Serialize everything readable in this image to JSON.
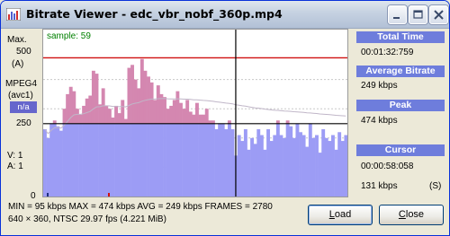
{
  "window": {
    "title": "Bitrate Viewer - edc_vbr_nobf_360p.mp4"
  },
  "axis": {
    "max_label": "Max.",
    "y_500": "500",
    "unit": "(A)",
    "codec": "MPEG4",
    "codec_sub": "(avc1)",
    "na": "n/a",
    "y_250": "250",
    "y_0": "0",
    "v_label": "V:  1",
    "a_label": "A:  1"
  },
  "graph": {
    "sample_label": "sample: 59"
  },
  "chart_data": {
    "type": "bar",
    "ylim": [
      0,
      500
    ],
    "max_line": 474,
    "avg_line": 249,
    "cursor_index": 59,
    "bitrate_kbps": [
      230,
      200,
      250,
      260,
      240,
      225,
      300,
      350,
      375,
      360,
      300,
      280,
      310,
      335,
      345,
      430,
      420,
      315,
      370,
      310,
      300,
      270,
      310,
      285,
      330,
      265,
      440,
      450,
      400,
      370,
      470,
      430,
      410,
      390,
      330,
      380,
      350,
      340,
      300,
      310,
      330,
      360,
      320,
      300,
      330,
      290,
      280,
      320,
      280,
      280,
      300,
      260,
      260,
      230,
      250,
      250,
      230,
      260,
      230,
      140,
      210,
      190,
      230,
      160,
      200,
      180,
      230,
      210,
      160,
      230,
      190,
      210,
      260,
      210,
      200,
      260,
      240,
      200,
      250,
      220,
      210,
      170,
      250,
      200,
      210,
      150,
      230,
      200,
      190,
      210,
      160,
      220,
      190,
      210
    ]
  },
  "panel": {
    "total_time_label": "Total Time",
    "total_time_value": "00:01:32:759",
    "avg_bitrate_label": "Average Bitrate",
    "avg_bitrate_value": "249 kbps",
    "peak_label": "Peak",
    "peak_value": "474 kbps",
    "cursor_label": "Cursor",
    "cursor_time": "00:00:58:058",
    "cursor_bitrate": "131 kbps",
    "cursor_type": "(S)"
  },
  "stats": {
    "line1": "MIN = 95 kbps  MAX = 474 kbps  AVG = 249 kbps  FRAMES = 2780",
    "line2": "640 × 360, NTSC 29.97 fps          (4.221 MiB)"
  },
  "buttons": {
    "load_prefix": "",
    "load_accel": "L",
    "load_rest": "oad",
    "close_prefix": "",
    "close_accel": "C",
    "close_rest": "lose"
  },
  "colors": {
    "bar_fill": "#9c9cf5",
    "bar_peak": "#d487b0",
    "max_line": "#d01010",
    "avg_line": "#000000",
    "header_bg": "#6e7ddc"
  }
}
